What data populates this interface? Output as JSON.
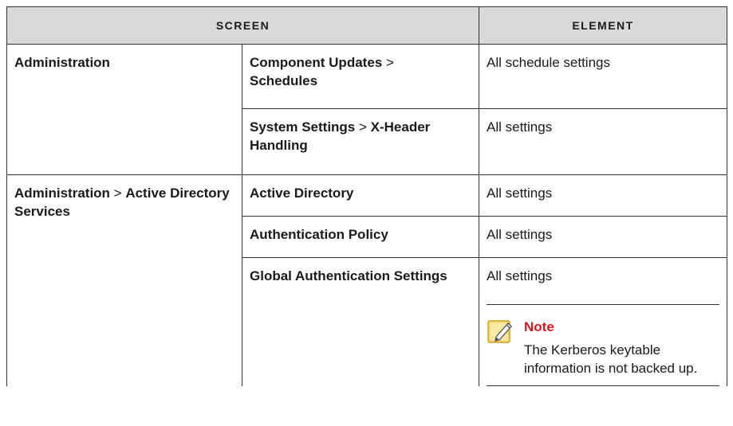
{
  "table": {
    "headers": {
      "screen": "Screen",
      "element": "Element"
    },
    "groups": [
      {
        "screen": {
          "parts": [
            {
              "text": "Administration",
              "bold": true
            }
          ]
        },
        "rows": [
          {
            "sub": {
              "a": "Component Updates",
              "sep": " > ",
              "b": "Schedules"
            },
            "element": "All schedule settings"
          },
          {
            "sub": {
              "a": "System Settings",
              "sep": " > ",
              "b": "X-Header Handling"
            },
            "element": "All settings"
          }
        ]
      },
      {
        "screen": {
          "a": "Administration",
          "sep": " > ",
          "b": "Active Directory Services"
        },
        "rows": [
          {
            "sub": {
              "a": "Active Directory"
            },
            "element": "All settings"
          },
          {
            "sub": {
              "a": "Authentication Policy"
            },
            "element": "All settings"
          },
          {
            "sub": {
              "a": "Global Authentication Settings"
            },
            "element": "All settings",
            "note": {
              "title": "Note",
              "text": "The Kerberos keytable information is not backed up."
            }
          }
        ]
      }
    ]
  },
  "colors": {
    "header_bg": "#d9d9d9",
    "note_title": "#d71920",
    "note_icon": "#f2c94c"
  },
  "icons": {
    "note": "note-pencil-icon"
  }
}
